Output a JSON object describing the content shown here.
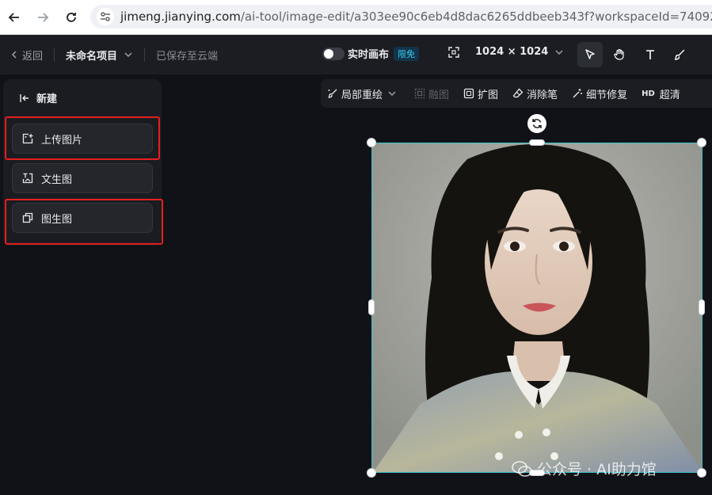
{
  "browser": {
    "url_host": "jimeng.jianying.com",
    "url_path": "/ai-tool/image-edit/a303ee90c6eb4d8dac6265ddbeeb343f?workspaceId=74092055612434"
  },
  "header": {
    "back_label": "返回",
    "project_name": "未命名项目",
    "saved_status": "已保存至云端",
    "realtime_label": "实时画布",
    "realtime_badge": "限免",
    "canvas_size": "1024 × 1024"
  },
  "left_panel": {
    "new_label": "新建",
    "buttons": [
      {
        "label": "上传图片"
      },
      {
        "label": "文生图"
      },
      {
        "label": "图生图"
      }
    ]
  },
  "canvas_toolbar": {
    "items": [
      {
        "label": "局部重绘"
      },
      {
        "label": "融图"
      },
      {
        "label": "扩图"
      },
      {
        "label": "消除笔"
      },
      {
        "label": "细节修复"
      },
      {
        "label": "超清",
        "prefix": "HD"
      }
    ]
  },
  "watermark": {
    "text": "公众号 · AI助力馆"
  },
  "colors": {
    "accent_cyan": "#39c2cc",
    "highlight_red": "#e51f1f",
    "badge_text": "#37c9ee"
  }
}
